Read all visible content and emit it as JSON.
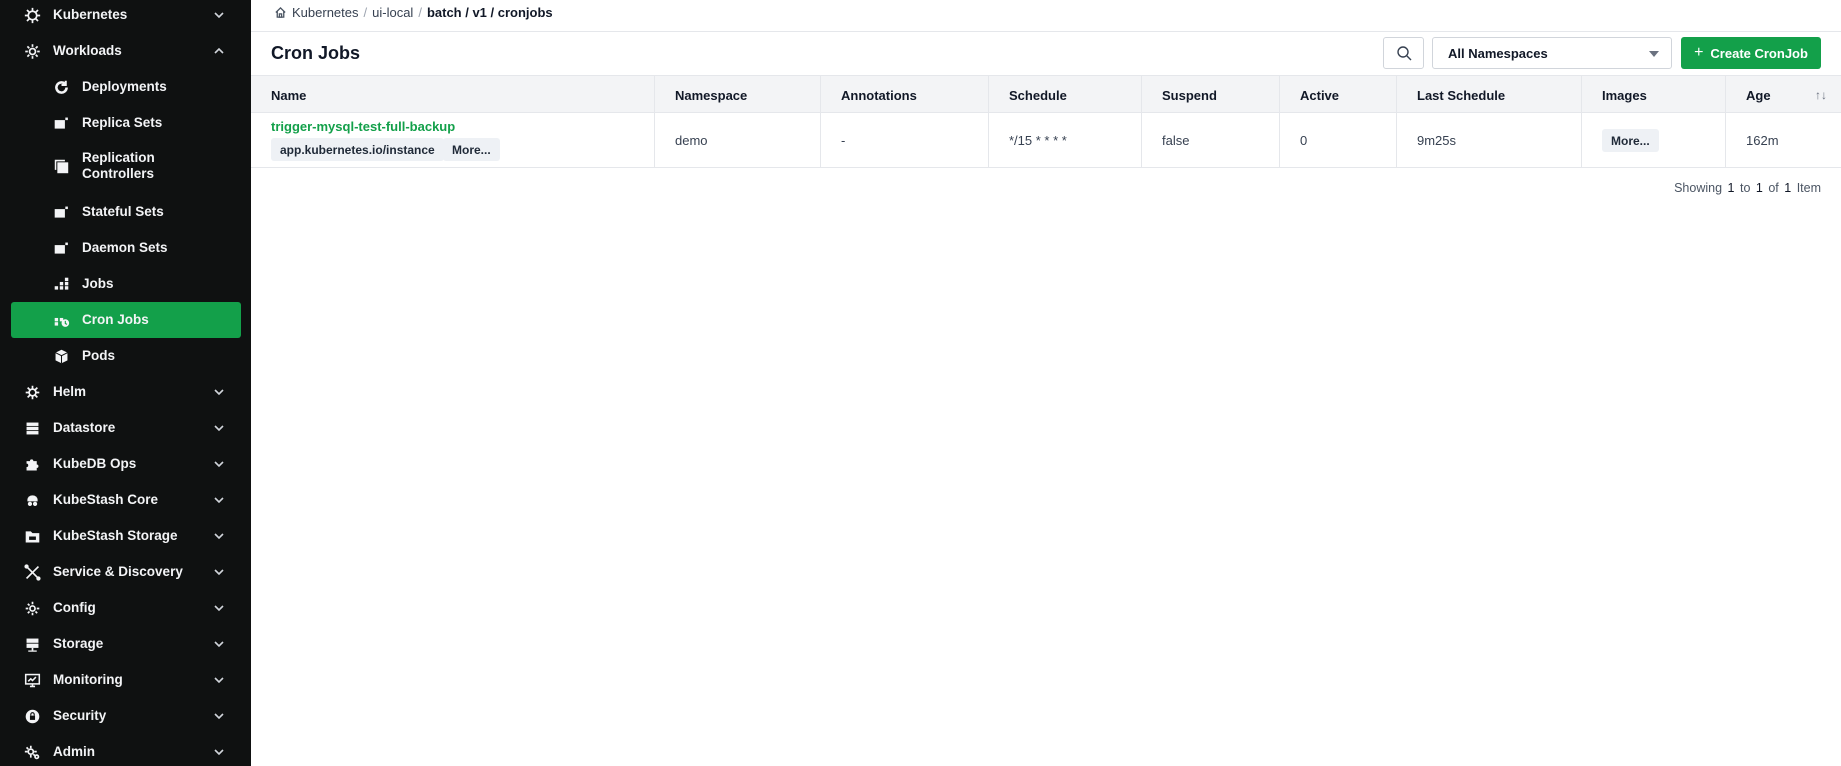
{
  "sidebar": {
    "items": [
      {
        "label": "Kubernetes",
        "icon": "helm-wheel-icon"
      },
      {
        "label": "Workloads",
        "icon": "workloads-gear-icon"
      },
      {
        "label": "Deployments",
        "icon": "deployment-icon"
      },
      {
        "label": "Replica Sets",
        "icon": "replicaset-icon"
      },
      {
        "label": "Replication Controllers",
        "icon": "replication-controller-icon"
      },
      {
        "label": "Stateful Sets",
        "icon": "statefulset-icon"
      },
      {
        "label": "Daemon Sets",
        "icon": "daemonset-icon"
      },
      {
        "label": "Jobs",
        "icon": "jobs-grid-icon"
      },
      {
        "label": "Cron Jobs",
        "icon": "cronjob-icon",
        "active": true
      },
      {
        "label": "Pods",
        "icon": "pod-cube-icon"
      },
      {
        "label": "Helm",
        "icon": "helm-icon"
      },
      {
        "label": "Datastore",
        "icon": "datastore-icon"
      },
      {
        "label": "KubeDB Ops",
        "icon": "puzzle-icon"
      },
      {
        "label": "KubeStash Core",
        "icon": "kubestash-core-icon"
      },
      {
        "label": "KubeStash Storage",
        "icon": "folder-icon"
      },
      {
        "label": "Service & Discovery",
        "icon": "network-icon"
      },
      {
        "label": "Config",
        "icon": "config-gear-icon"
      },
      {
        "label": "Storage",
        "icon": "storage-icon"
      },
      {
        "label": "Monitoring",
        "icon": "monitor-icon"
      },
      {
        "label": "Security",
        "icon": "lock-icon"
      },
      {
        "label": "Admin",
        "icon": "admin-gear-icon"
      }
    ]
  },
  "breadcrumb": {
    "root": "Kubernetes",
    "cluster": "ui-local",
    "current": "batch / v1 / cronjobs"
  },
  "header": {
    "title": "Cron Jobs",
    "namespace_select": "All Namespaces",
    "create_label": "Create CronJob"
  },
  "table": {
    "columns": [
      "Name",
      "Namespace",
      "Annotations",
      "Schedule",
      "Suspend",
      "Active",
      "Last Schedule",
      "Images",
      "Age"
    ],
    "rows": [
      {
        "name": "trigger-mysql-test-full-backup",
        "label_tag": "app.kubernetes.io/instance",
        "labels_more": "More...",
        "namespace": "demo",
        "annotations": "-",
        "schedule": "*/15 * * * *",
        "suspend": "false",
        "active": "0",
        "last_schedule": "9m25s",
        "images_more": "More...",
        "age": "162m"
      }
    ]
  },
  "pager": {
    "prefix": "Showing",
    "from": "1",
    "to_word": "to",
    "to": "1",
    "of_word": "of",
    "total": "1",
    "unit": "Item"
  },
  "colors": {
    "accent": "#13a04a",
    "sidebar_bg": "#0f1111"
  }
}
